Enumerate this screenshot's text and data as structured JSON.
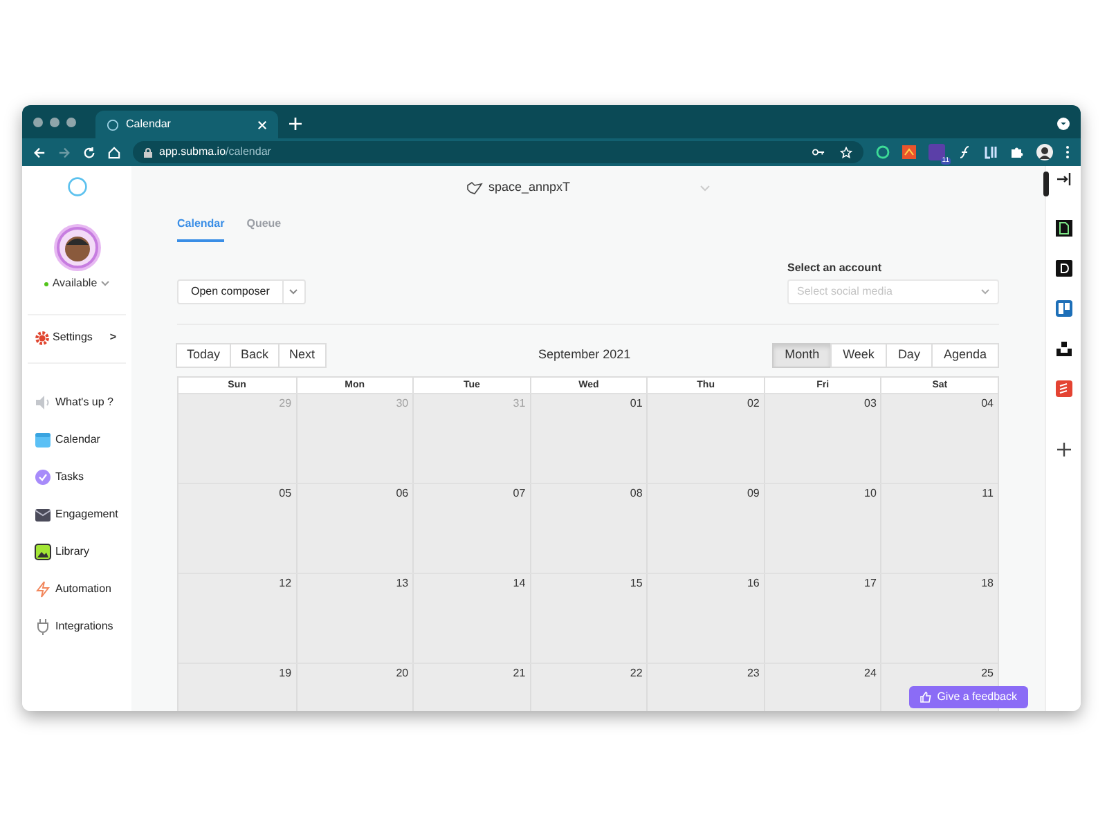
{
  "browser": {
    "tab_title": "Calendar",
    "url_host": "app.subma.io",
    "url_path": "/calendar",
    "extension_badge": "11"
  },
  "sidebar": {
    "status": "Available",
    "settings": "Settings",
    "settings_arrow": ">",
    "items": [
      {
        "label": "What's up ?"
      },
      {
        "label": "Calendar"
      },
      {
        "label": "Tasks"
      },
      {
        "label": "Engagement"
      },
      {
        "label": "Library"
      },
      {
        "label": "Automation"
      },
      {
        "label": "Integrations"
      }
    ]
  },
  "workspace": "space_annpxT",
  "tabs": [
    {
      "label": "Calendar",
      "selected": true
    },
    {
      "label": "Queue",
      "selected": false
    }
  ],
  "composer": {
    "label": "Open composer"
  },
  "account": {
    "label": "Select an account",
    "placeholder": "Select social media"
  },
  "toolbar": {
    "nav": [
      "Today",
      "Back",
      "Next"
    ],
    "title": "September 2021",
    "views": [
      {
        "label": "Month",
        "selected": true
      },
      {
        "label": "Week",
        "selected": false
      },
      {
        "label": "Day",
        "selected": false
      },
      {
        "label": "Agenda",
        "selected": false
      }
    ]
  },
  "weekdays": [
    "Sun",
    "Mon",
    "Tue",
    "Wed",
    "Thu",
    "Fri",
    "Sat"
  ],
  "weeks": [
    [
      {
        "day": "29",
        "outside": true
      },
      {
        "day": "30",
        "outside": true
      },
      {
        "day": "31",
        "outside": true
      },
      {
        "day": "01",
        "outside": false
      },
      {
        "day": "02",
        "outside": false
      },
      {
        "day": "03",
        "outside": false
      },
      {
        "day": "04",
        "outside": false
      }
    ],
    [
      {
        "day": "05",
        "outside": false
      },
      {
        "day": "06",
        "outside": false
      },
      {
        "day": "07",
        "outside": false
      },
      {
        "day": "08",
        "outside": false
      },
      {
        "day": "09",
        "outside": false
      },
      {
        "day": "10",
        "outside": false
      },
      {
        "day": "11",
        "outside": false
      }
    ],
    [
      {
        "day": "12",
        "outside": false
      },
      {
        "day": "13",
        "outside": false
      },
      {
        "day": "14",
        "outside": false
      },
      {
        "day": "15",
        "outside": false
      },
      {
        "day": "16",
        "outside": false
      },
      {
        "day": "17",
        "outside": false
      },
      {
        "day": "18",
        "outside": false
      }
    ],
    [
      {
        "day": "19",
        "outside": false
      },
      {
        "day": "20",
        "outside": false
      },
      {
        "day": "21",
        "outside": false
      },
      {
        "day": "22",
        "outside": false
      },
      {
        "day": "23",
        "outside": false
      },
      {
        "day": "24",
        "outside": false
      },
      {
        "day": "25",
        "outside": false
      }
    ]
  ],
  "feedback": "Give a feedback"
}
